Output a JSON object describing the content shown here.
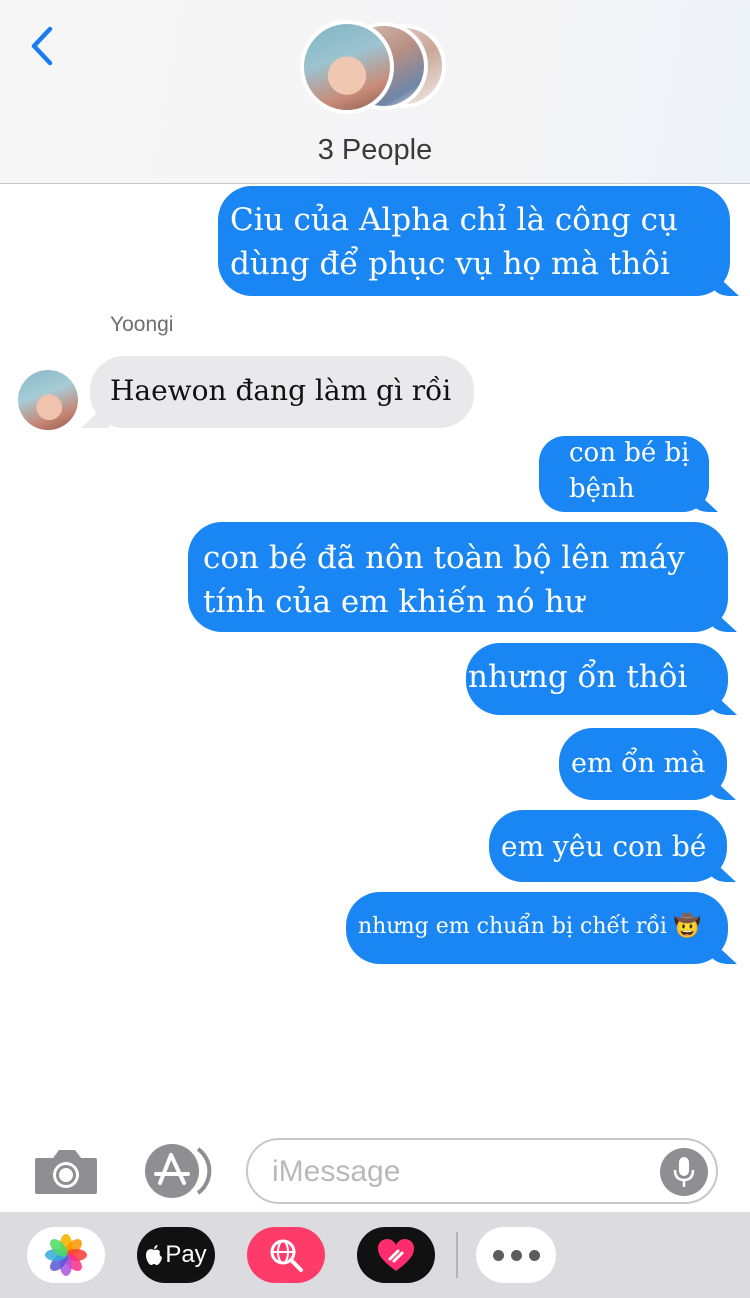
{
  "header": {
    "back_icon": "chevron-left-icon",
    "group_name": "3 People",
    "accent_color": "#1a7cf2"
  },
  "messages": [
    {
      "direction": "outgoing",
      "lines": [
        "Ciu của Alpha chỉ là công cụ",
        "dùng để phục vụ họ mà thôi"
      ]
    },
    {
      "direction": "incoming",
      "sender": "Yoongi",
      "lines": [
        "Haewon đang làm gì rồi"
      ]
    },
    {
      "direction": "outgoing",
      "lines": [
        "con bé bị",
        "bệnh"
      ]
    },
    {
      "direction": "outgoing",
      "lines": [
        "con bé đã nôn toàn bộ lên máy",
        "tính của em khiến nó hư"
      ]
    },
    {
      "direction": "outgoing",
      "lines": [
        "nhưng ổn thôi"
      ]
    },
    {
      "direction": "outgoing",
      "lines": [
        "em ổn mà"
      ]
    },
    {
      "direction": "outgoing",
      "lines": [
        "em yêu con bé"
      ]
    },
    {
      "direction": "outgoing",
      "lines": [
        "nhưng em chuẩn bị chết rồi 🤠"
      ]
    }
  ],
  "colors": {
    "outgoing_bubble": "#1a86f3",
    "incoming_bubble": "#e9e9eb"
  },
  "input_bar": {
    "camera_icon": "camera-icon",
    "appstore_icon": "app-store-icon",
    "placeholder": "iMessage",
    "mic_icon": "microphone-icon"
  },
  "app_drawer": {
    "apps": [
      "photos-icon",
      "apple-pay-icon",
      "web-search-icon",
      "digital-touch-icon",
      "more-icon"
    ],
    "apple_pay_label": "Pay"
  }
}
